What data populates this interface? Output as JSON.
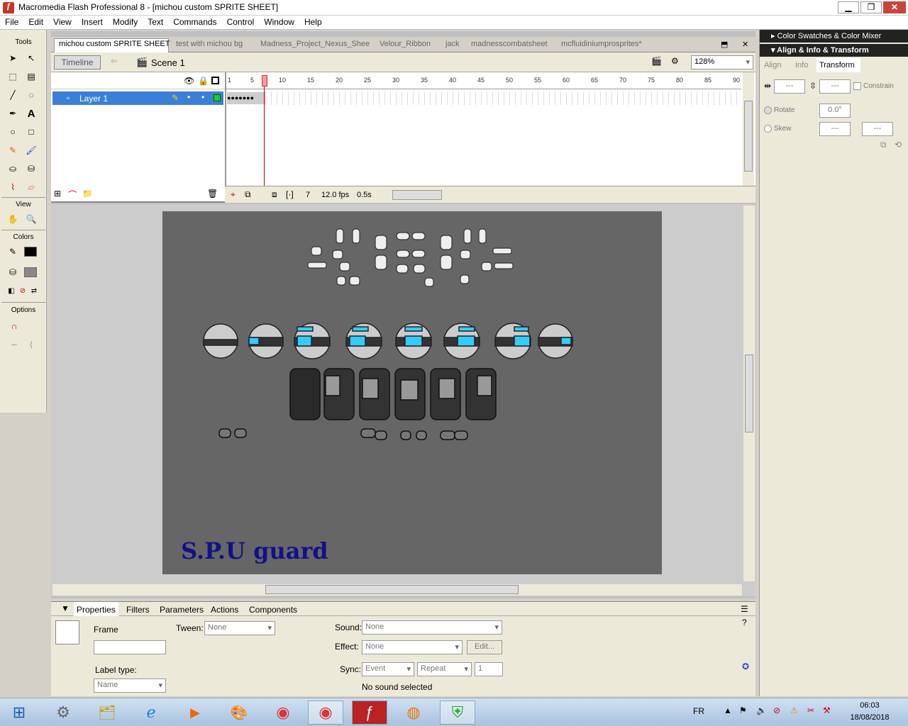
{
  "window": {
    "title": "Macromedia Flash Professional 8 - [michou custom SPRITE SHEET]"
  },
  "menu": [
    "File",
    "Edit",
    "View",
    "Insert",
    "Modify",
    "Text",
    "Commands",
    "Control",
    "Window",
    "Help"
  ],
  "tools": {
    "title": "Tools",
    "view": "View",
    "colors": "Colors",
    "options": "Options"
  },
  "tabs": [
    "michou custom SPRITE SHEET",
    "test with michou bg",
    "Madness_Project_Nexus_Shee",
    "Velour_Ribbon",
    "jack",
    "madnesscombatsheet",
    "mcfluidiniumprosprites*"
  ],
  "editbar": {
    "timeline": "Timeline",
    "scene": "Scene 1",
    "zoom": "128%"
  },
  "timeline": {
    "layer": "Layer 1",
    "ruler": [
      "1",
      "5",
      "10",
      "15",
      "20",
      "25",
      "30",
      "35",
      "40",
      "45",
      "50",
      "55",
      "60",
      "65",
      "70",
      "75",
      "80",
      "85",
      "90"
    ],
    "frame": "7",
    "fps": "12.0 fps",
    "time": "0.5s",
    "playhead": 7
  },
  "stage": {
    "label": "S.P.U guard"
  },
  "props": {
    "tabs": [
      "Properties",
      "Filters",
      "Parameters",
      "Actions",
      "Components"
    ],
    "frame": "Frame",
    "tween_label": "Tween:",
    "tween": "None",
    "sound_label": "Sound:",
    "sound": "None",
    "effect_label": "Effect:",
    "effect": "None",
    "edit": "Edit...",
    "labeltype": "Label type:",
    "name": "Name",
    "sync_label": "Sync:",
    "sync": "Event",
    "repeat": "Repeat",
    "count": "1",
    "nosound": "No sound selected"
  },
  "right": {
    "swatches": "Color Swatches & Color Mixer",
    "align": "Align & Info & Transform",
    "tabs": [
      "Align",
      "Info",
      "Transform"
    ],
    "w": "---",
    "h": "---",
    "constrain": "Constrain",
    "rotate": "Rotate",
    "rotval": "0.0°",
    "skew": "Skew",
    "sk1": "---",
    "sk2": "---"
  },
  "taskbar": {
    "lang": "FR",
    "time": "06:03",
    "date": "18/08/2018"
  }
}
